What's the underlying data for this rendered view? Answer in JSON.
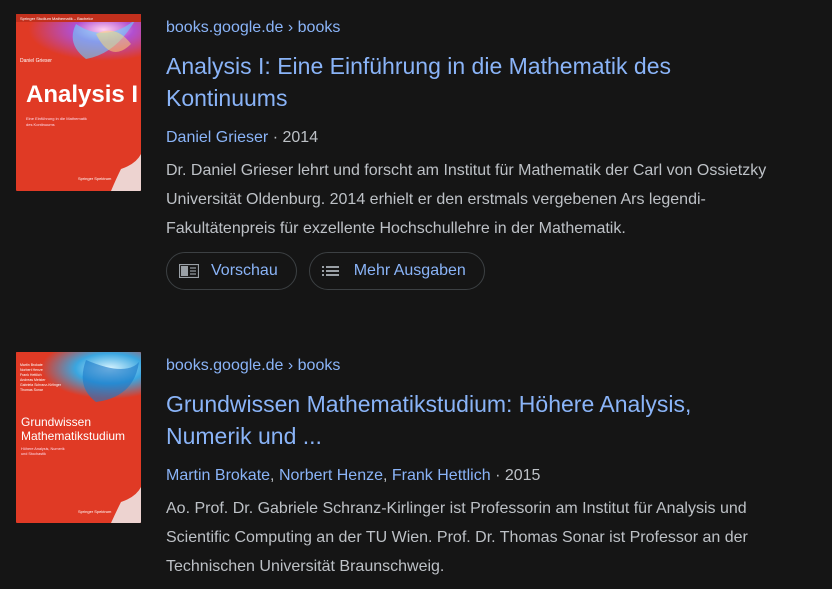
{
  "results": [
    {
      "breadcrumb": "books.google.de › books",
      "title_line1": "Analysis I: Eine Einführung in die Mathematik des",
      "title_line2": "Kontinuums",
      "author": "Daniel Grieser",
      "year": "· 2014",
      "snippet": [
        "Dr. Daniel Grieser lehrt und forscht am Institut für Mathematik der Carl von Ossietzky",
        "Universität Oldenburg. 2014 erhielt er den erstmals vergebenen Ars legendi-",
        "Fakultätenpreis für exzellente Hochschullehre in der Mathematik."
      ],
      "preview_label": "Vorschau",
      "more_editions_label": "Mehr Ausgaben",
      "cover": {
        "series": "Springer Studium Mathematik – Bachelor",
        "author": "Daniel Grieser",
        "title": "Analysis I",
        "subtitle": [
          "Eine Einführung in die Mathematik",
          "des Kontinuums"
        ],
        "publisher": "Springer Spektrum",
        "color": "#e03a25"
      }
    },
    {
      "breadcrumb": "books.google.de › books",
      "title_line1": "Grundwissen Mathematikstudium: Höhere Analysis,",
      "title_line2": "Numerik und ...",
      "authors": [
        "Martin Brokate",
        "Norbert Henze",
        "Frank Hettlich"
      ],
      "sep1": ",",
      "sep2": ",",
      "year": "· 2015",
      "snippet": [
        "Ao. Prof. Dr. Gabriele Schranz-Kirlinger ist Professorin am Institut für Analysis und",
        "Scientific Computing an der TU Wien. Prof. Dr. Thomas Sonar ist Professor an der",
        "Technischen Universität Braunschweig."
      ],
      "cover": {
        "names": [
          "Martin Brokate",
          "Norbert Henze",
          "Frank Hettlich",
          "Andreas Meister",
          "Gabriela Schranz-Kirlinger",
          "Thomas Sonar"
        ],
        "title": [
          "Grundwissen",
          "Mathematikstudium"
        ],
        "subtitle": [
          "Höhere Analysis, Numerik",
          "und Stochastik"
        ],
        "publisher": "Springer Spektrum",
        "color": "#e03a25"
      }
    }
  ]
}
